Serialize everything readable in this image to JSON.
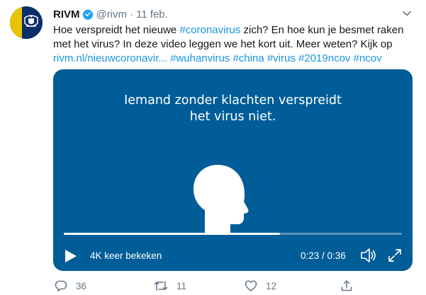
{
  "tweet": {
    "author_name": "RIVM",
    "handle": "@rivm",
    "separator": "·",
    "date": "11 feb.",
    "text_line1_start": "Hoe verspreidt het nieuwe ",
    "tag_coronavirus": "#coronavirus",
    "text_line1_end": " zich? En hoe kun je besmet raken",
    "text_line2": "met het virus? In deze video leggen we het kort uit. Meer weten? Kijk op",
    "link": "rivm.nl/nieuwcoronavir...",
    "tags": [
      "#wuhanvirus",
      "#china",
      "#virus",
      "#2019ncov",
      "#ncov"
    ]
  },
  "video": {
    "caption_line1": "Iemand zonder klachten verspreidt",
    "caption_line2": "het virus niet.",
    "views": "4K keer bekeken",
    "time": "0:23 / 0:36",
    "progress_fraction": 0.639,
    "background_color": "#005d97"
  },
  "actions": {
    "replies": "36",
    "retweets": "11",
    "likes": "12"
  },
  "colors": {
    "link": "#1b95e0",
    "secondary": "#657786",
    "avatar_blue": "#0b2f6b",
    "avatar_yellow": "#e8c400"
  }
}
